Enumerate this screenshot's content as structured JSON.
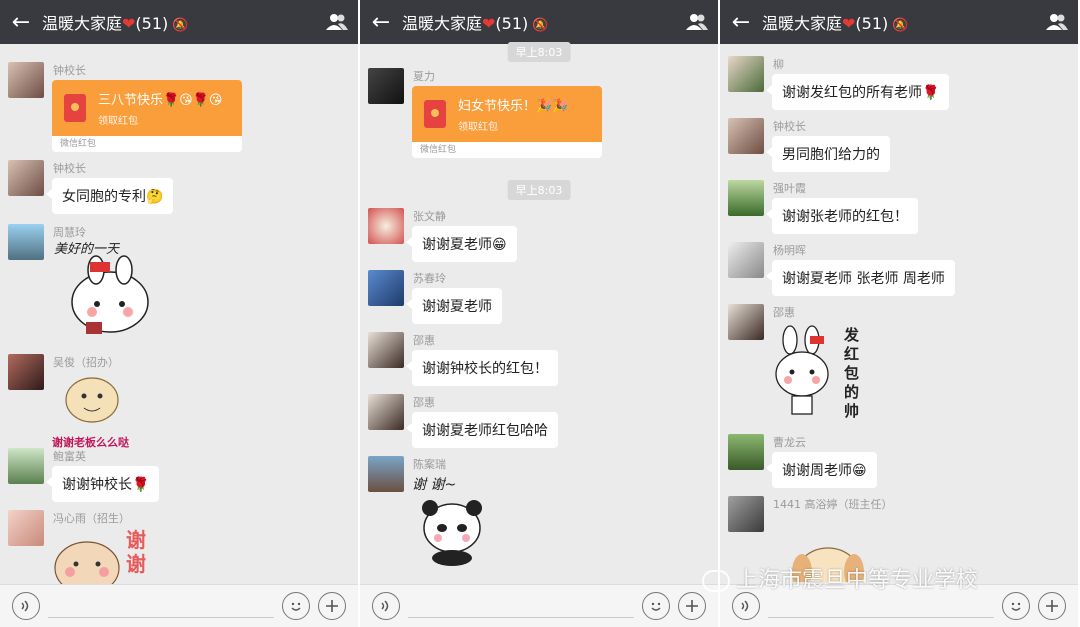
{
  "topbar": {
    "title": "温暖大家庭",
    "count": "(51)"
  },
  "icons": {
    "back": "←",
    "heart": "❤",
    "mute": "🔕",
    "group": "group-icon"
  },
  "panel1": {
    "time": "",
    "m1": {
      "name": "钟校长",
      "rp_title": "三八节快乐🌹😘🌹😘",
      "rp_sub": "领取红包",
      "rp_foot": "微信红包"
    },
    "m2": {
      "name": "钟校长",
      "text": "女同胞的专利🤔"
    },
    "m3": {
      "name": "周慧玲",
      "sticker_text": "美好的一天"
    },
    "m4": {
      "name": "吴俊（招办）",
      "sticker_text": "谢谢老板么么哒"
    },
    "m5": {
      "name": "鲍富英",
      "text": "谢谢钟校长🌹"
    },
    "m6": {
      "name": "冯心雨（招生）",
      "sticker_text": "谢谢"
    }
  },
  "panel2": {
    "time1": "早上8:03",
    "m1": {
      "name": "夏力",
      "rp_title": "妇女节快乐！🎉🎉",
      "rp_sub": "领取红包",
      "rp_foot": "微信红包"
    },
    "time2": "早上8:03",
    "m2": {
      "name": "张文静",
      "text": "谢谢夏老师😁"
    },
    "m3": {
      "name": "苏春玲",
      "text": "谢谢夏老师"
    },
    "m4": {
      "name": "邵惠",
      "text": "谢谢钟校长的红包！"
    },
    "m5": {
      "name": "邵惠",
      "text": "谢谢夏老师红包哈哈"
    },
    "m6": {
      "name": "陈案瑞",
      "sticker_text": "谢 谢~"
    }
  },
  "panel3": {
    "m1": {
      "name": "柳",
      "text": "谢谢发红包的所有老师🌹"
    },
    "m2": {
      "name": "钟校长",
      "text": "男同胞们给力的"
    },
    "m3": {
      "name": "强叶霞",
      "text": "谢谢张老师的红包！"
    },
    "m4": {
      "name": "杨明晖",
      "text": "谢谢夏老师  张老师  周老师"
    },
    "m5": {
      "name": "邵惠",
      "sticker_text": "发红包的帅"
    },
    "m6": {
      "name": "曹龙云",
      "text": "谢谢周老师😁"
    },
    "m7": {
      "name": "1441 高浴婷（班主任）"
    }
  },
  "watermark": "上海市震旦中等专业学校"
}
